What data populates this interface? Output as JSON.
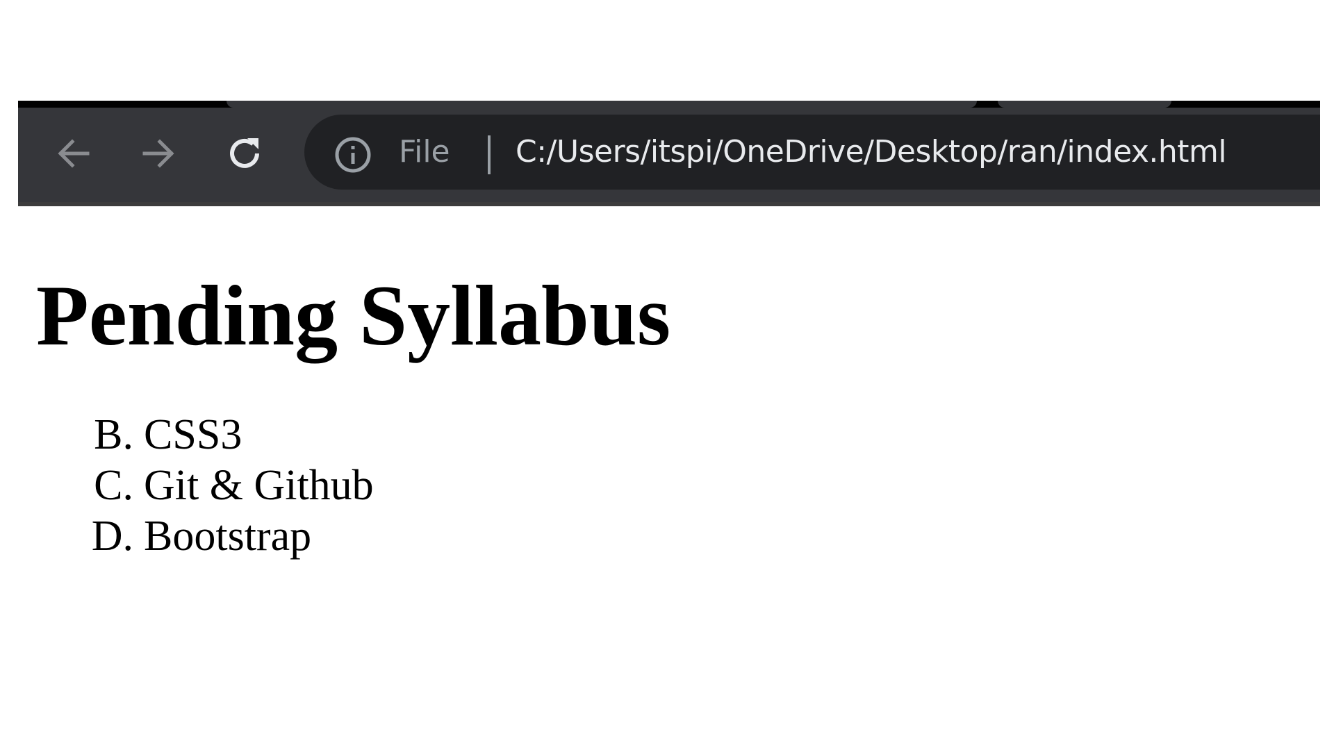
{
  "browser": {
    "address_bar": {
      "scheme_label": "File",
      "url": "C:/Users/itspi/OneDrive/Desktop/ran/index.html"
    },
    "icons": {
      "back": "back-arrow-icon",
      "forward": "forward-arrow-icon",
      "reload": "reload-icon",
      "site_info": "info-icon"
    },
    "colors": {
      "toolbar": "#35363a",
      "omnibox": "#202124",
      "url_text": "#e8eaed",
      "muted_text": "#9aa0a6"
    }
  },
  "page": {
    "title": "Pending Syllabus",
    "list_items": [
      {
        "marker": "B.",
        "text": "CSS3"
      },
      {
        "marker": "C.",
        "text": "Git & Github"
      },
      {
        "marker": "D.",
        "text": "Bootstrap"
      }
    ]
  }
}
